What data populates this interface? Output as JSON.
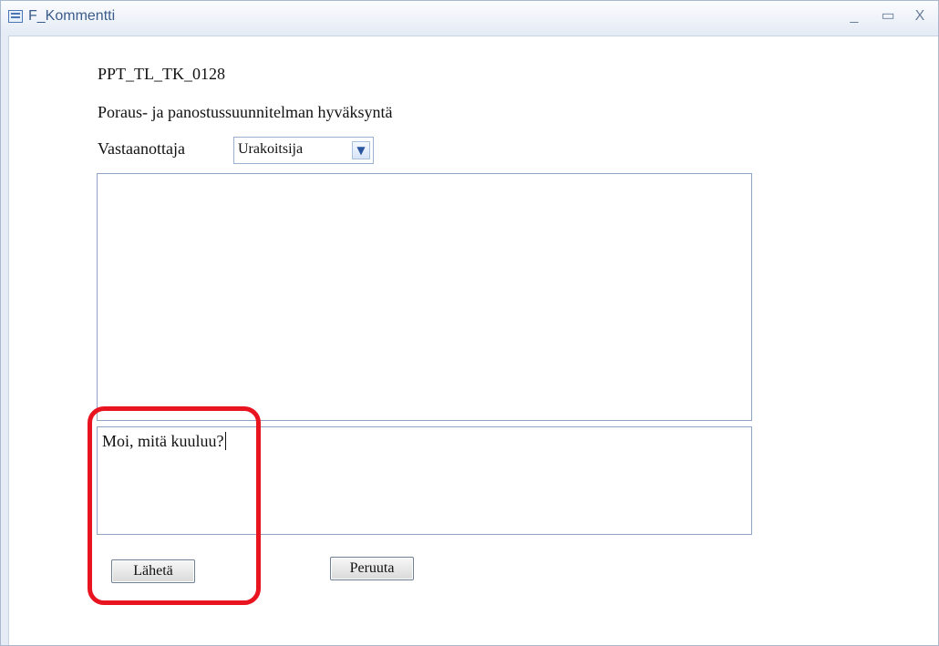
{
  "window": {
    "title": "F_Kommentti",
    "controls": {
      "minimize": "_",
      "maximize": "▭",
      "close": "X"
    }
  },
  "form": {
    "code": "PPT_TL_TK_0128",
    "subject": "Poraus- ja panostussuunnitelman hyväksyntä",
    "recipient_label": "Vastaanottaja",
    "recipient_value": "Urakoitsija",
    "history_text": "",
    "message_text": "Moi, mitä kuuluu?"
  },
  "buttons": {
    "send": "Lähetä",
    "cancel": "Peruuta"
  },
  "colors": {
    "highlight": "#e8141f",
    "title_text": "#3b5c8a",
    "field_border": "#8ea4c2"
  },
  "icons": {
    "window": "form-icon",
    "dropdown": "chevron-down-icon"
  }
}
